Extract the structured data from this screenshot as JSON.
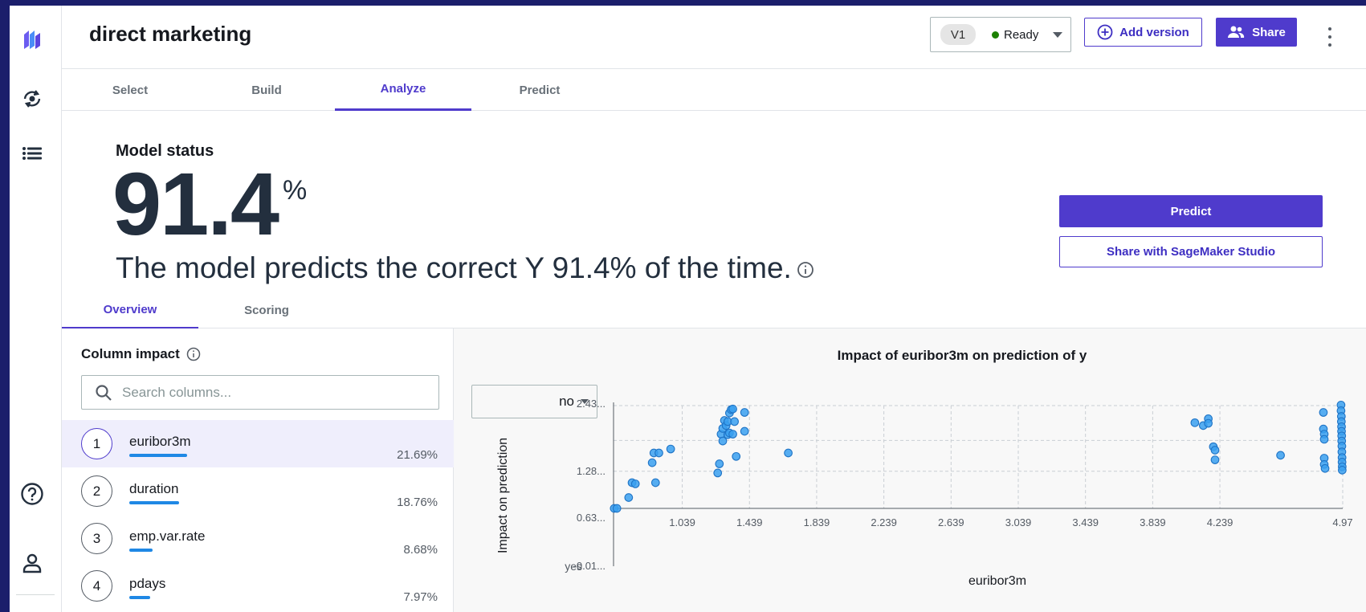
{
  "header": {
    "title": "direct marketing",
    "version_label": "V1",
    "status_label": "Ready",
    "add_version_label": "Add version",
    "share_label": "Share"
  },
  "tabs": [
    {
      "label": "Select"
    },
    {
      "label": "Build"
    },
    {
      "label": "Analyze",
      "active": true
    },
    {
      "label": "Predict"
    }
  ],
  "model_status": {
    "title": "Model status",
    "accuracy_value": "91.4",
    "accuracy_unit": "%",
    "sentence": "The model predicts the correct Y 91.4% of the time.",
    "predict_label": "Predict",
    "share_studio_label": "Share with SageMaker Studio"
  },
  "subtabs": [
    {
      "label": "Overview",
      "active": true
    },
    {
      "label": "Scoring"
    }
  ],
  "column_impact": {
    "title": "Column impact",
    "search_placeholder": "Search columns...",
    "rows": [
      {
        "rank": "1",
        "name": "euribor3m",
        "pct": "21.69%",
        "value": 0.2169,
        "selected": true
      },
      {
        "rank": "2",
        "name": "duration",
        "pct": "18.76%",
        "value": 0.1876
      },
      {
        "rank": "3",
        "name": "emp.var.rate",
        "pct": "8.68%",
        "value": 0.0868
      },
      {
        "rank": "4",
        "name": "pdays",
        "pct": "7.97%",
        "value": 0.0797
      }
    ]
  },
  "colors": {
    "accent": "#4f3bcc",
    "point": "#3aa0f0",
    "point_stroke": "#1f74c6",
    "bar": "#1f88e5",
    "ready": "#1d8102"
  },
  "chart_data": {
    "type": "scatter",
    "title": "Impact of euribor3m on prediction of y",
    "xlabel": "euribor3m",
    "ylabel": "Impact on prediction",
    "class_selector": "no",
    "class_bottom_label": "yes",
    "x_ticks": [
      "1.039",
      "1.439",
      "1.839",
      "2.239",
      "2.639",
      "3.039",
      "3.439",
      "3.839",
      "4.239",
      "4.97"
    ],
    "x_tick_values": [
      1.039,
      1.439,
      1.839,
      2.239,
      2.639,
      3.039,
      3.439,
      3.839,
      4.239,
      4.97
    ],
    "y_ticks": [
      "2.43...",
      "1.28...",
      "0.63...",
      "-0.01..."
    ],
    "y_tick_values": [
      2.43,
      1.28,
      0.63,
      -0.01
    ],
    "xlim": [
      0.63,
      4.97
    ],
    "grid": true,
    "points": [
      [
        0.634,
        0.63
      ],
      [
        0.65,
        0.63
      ],
      [
        0.72,
        0.82
      ],
      [
        0.74,
        1.08
      ],
      [
        0.76,
        1.06
      ],
      [
        0.88,
        1.08
      ],
      [
        0.86,
        1.43
      ],
      [
        0.87,
        1.6
      ],
      [
        0.9,
        1.6
      ],
      [
        0.97,
        1.67
      ],
      [
        1.25,
        1.25
      ],
      [
        1.26,
        1.41
      ],
      [
        1.27,
        1.93
      ],
      [
        1.28,
        1.81
      ],
      [
        1.28,
        2.03
      ],
      [
        1.29,
        2.17
      ],
      [
        1.3,
        2.08
      ],
      [
        1.31,
        2.15
      ],
      [
        1.31,
        1.92
      ],
      [
        1.32,
        1.95
      ],
      [
        1.32,
        2.3
      ],
      [
        1.33,
        2.36
      ],
      [
        1.34,
        2.37
      ],
      [
        1.34,
        1.93
      ],
      [
        1.35,
        2.15
      ],
      [
        1.36,
        1.54
      ],
      [
        1.41,
        2.31
      ],
      [
        1.41,
        1.98
      ],
      [
        1.67,
        1.6
      ],
      [
        4.09,
        2.13
      ],
      [
        4.14,
        2.08
      ],
      [
        4.17,
        2.2
      ],
      [
        4.17,
        2.12
      ],
      [
        4.2,
        1.71
      ],
      [
        4.21,
        1.65
      ],
      [
        4.21,
        1.48
      ],
      [
        4.6,
        1.56
      ],
      [
        4.855,
        2.31
      ],
      [
        4.855,
        2.02
      ],
      [
        4.86,
        1.93
      ],
      [
        4.86,
        1.84
      ],
      [
        4.86,
        1.51
      ],
      [
        4.86,
        1.4
      ],
      [
        4.865,
        1.33
      ],
      [
        4.96,
        2.44
      ],
      [
        4.96,
        2.34
      ],
      [
        4.962,
        2.24
      ],
      [
        4.962,
        2.15
      ],
      [
        4.963,
        2.06
      ],
      [
        4.963,
        1.98
      ],
      [
        4.964,
        1.9
      ],
      [
        4.964,
        1.81
      ],
      [
        4.965,
        1.72
      ],
      [
        4.965,
        1.62
      ],
      [
        4.966,
        1.52
      ],
      [
        4.966,
        1.44
      ],
      [
        4.967,
        1.36
      ],
      [
        4.967,
        1.3
      ]
    ]
  }
}
